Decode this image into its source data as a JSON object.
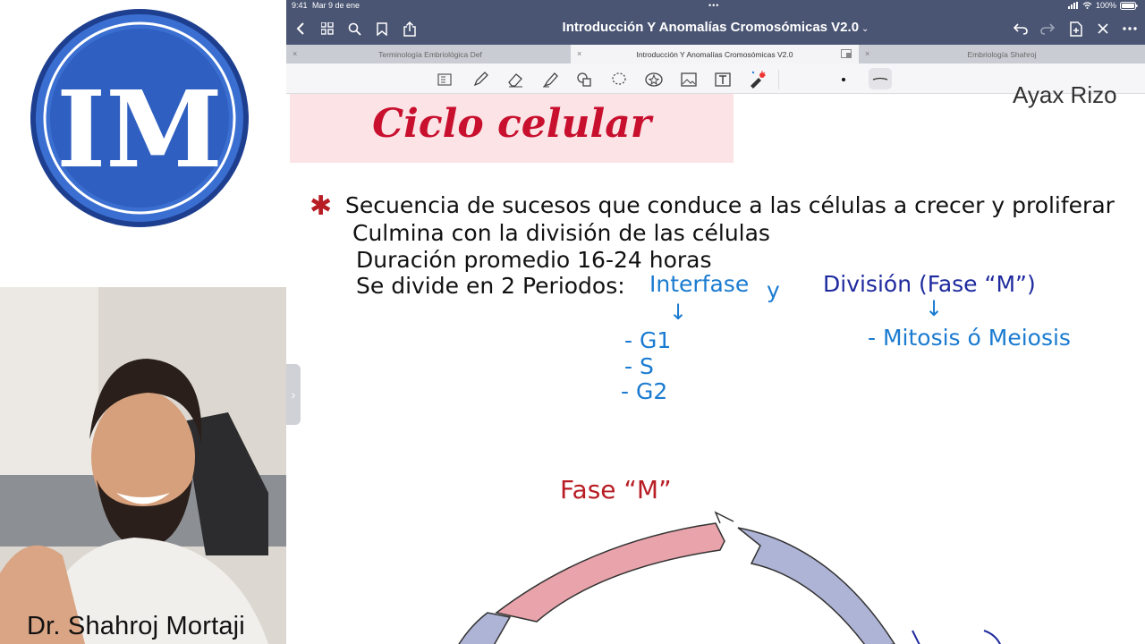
{
  "presenter": {
    "logo_text": "IM",
    "name": "Dr. Shahroj Mortaji"
  },
  "status_bar": {
    "time": "9:41",
    "date": "Mar 9 de ene",
    "battery": "100%"
  },
  "nav": {
    "title": "Introducción Y Anomalías Cromosómicas  V2.0",
    "icons": [
      "back-icon",
      "grid-icon",
      "search-icon",
      "bookmark-icon",
      "share-icon",
      "undo-icon",
      "redo-icon",
      "add-page-icon",
      "close-icon",
      "more-icon"
    ]
  },
  "tabs": [
    {
      "label": "Terminología Embriológica Def",
      "active": false
    },
    {
      "label": "Introducción Y Anomalías Cromosómicas  V2.0",
      "active": true
    },
    {
      "label": "Embriología Shahroj",
      "active": false
    }
  ],
  "toolbar": {
    "tools": [
      "reader-icon",
      "pen-icon",
      "eraser-icon",
      "highlighter-icon",
      "shapes-icon",
      "lasso-icon",
      "sticker-icon",
      "image-icon",
      "text-icon",
      "laser-icon"
    ]
  },
  "note": {
    "title": "Ciclo celular",
    "author": "Ayax Rizo",
    "bullet": "✱",
    "lines": [
      "Secuencia de sucesos que conduce a las células a crecer y proliferar",
      "Culmina con la división de las células",
      "Duración promedio 16-24 horas",
      "Se divide en 2 Periodos:"
    ],
    "interfase": "Interfase",
    "conjunction": "y",
    "division": "División (Fase “M”)",
    "arrow": "↓",
    "interfase_items": [
      "- G1",
      "- S",
      "- G2"
    ],
    "division_items": [
      "- Mitosis ó Meiosis"
    ],
    "diagram_label": "Fase “M”"
  },
  "colors": {
    "nav_bg": "#4a5573",
    "title_red": "#c8102e",
    "banner_pink": "#fbe3e6",
    "ink_blue": "#1a7bd1",
    "ink_navy": "#1e2a9e",
    "ink_red": "#b81d24"
  }
}
